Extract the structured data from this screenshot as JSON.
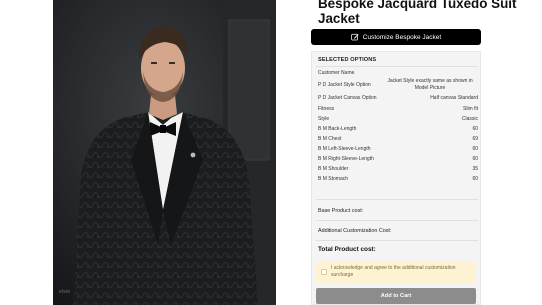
{
  "product": {
    "title": "Bespoke Jacquard Tuxedo Suit Jacket",
    "image_watermark": "elsie"
  },
  "customize_button": {
    "label": "Customize Bespoke Jacket",
    "icon": "pencil-icon"
  },
  "selected_options": {
    "heading": "SELECTED OPTIONS",
    "rows": [
      {
        "label": "Customer Name",
        "value": ""
      },
      {
        "label": "P D Jacket Style Option",
        "value": "Jacket Style exactly same as shown in Model Picture"
      },
      {
        "label": "P D Jacket Canvas Option",
        "value": "Half canvas Standard"
      },
      {
        "label": "Fitness",
        "value": "Slim fit"
      },
      {
        "label": "Style",
        "value": "Classic"
      },
      {
        "label": "B M Back-Length",
        "value": "60"
      },
      {
        "label": "B M Chest",
        "value": "69"
      },
      {
        "label": "B M Left-Sleeve-Length",
        "value": "60"
      },
      {
        "label": "B M Right-Sleeve-Length",
        "value": "60"
      },
      {
        "label": "B M Shoulder",
        "value": "35"
      },
      {
        "label": "B M Stomach",
        "value": "60"
      }
    ]
  },
  "costs": {
    "base_label": "Base Product cost:",
    "additional_label": "Additional Customization Cost:",
    "total_label": "Total Product cost:"
  },
  "acknowledge": {
    "text": "I acknowledge and agree to the additional customization surcharge",
    "checked": false
  },
  "add_to_cart": {
    "label": "Add to Cart"
  },
  "colors": {
    "button_dark": "#000000",
    "panel_bg": "#f4f4f4",
    "ack_bg": "#fdf3d3",
    "cart_disabled": "#8c8c8c"
  }
}
